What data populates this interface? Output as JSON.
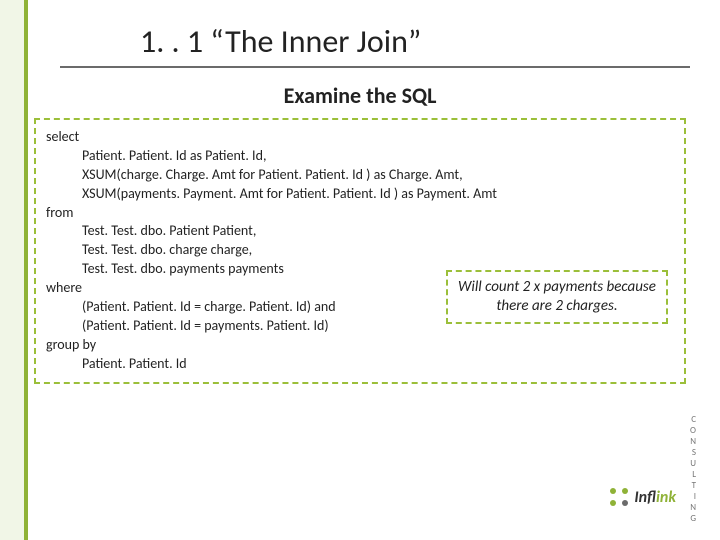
{
  "title": "1. . 1 “The Inner Join”",
  "subtitle": "Examine the SQL",
  "sql": {
    "l01": "select",
    "l02": "Patient. Patient. Id  as  Patient. Id,",
    "l03": "XSUM(charge. Charge. Amt  for Patient. Patient. Id )  as  Charge. Amt,",
    "l04": "XSUM(payments. Payment. Amt  for Patient. Patient. Id )  as  Payment. Amt",
    "l05": "from",
    "l06": "Test. Test. dbo. Patient Patient,",
    "l07": "Test. Test. dbo. charge charge,",
    "l08": "Test. Test. dbo. payments payments",
    "l09": "where",
    "l10": "(Patient. Patient. Id = charge. Patient. Id) and",
    "l11": "(Patient. Patient. Id = payments. Patient. Id)",
    "l12": "group by",
    "l13": "Patient. Patient. Id"
  },
  "callout": "Will count 2 x payments because there are 2 charges.",
  "logo": {
    "brand_a": "Inf",
    "brand_b": "link",
    "sub": "C O N S U L T I N G"
  },
  "colors": {
    "accent": "#8fb237",
    "text": "#222222"
  }
}
